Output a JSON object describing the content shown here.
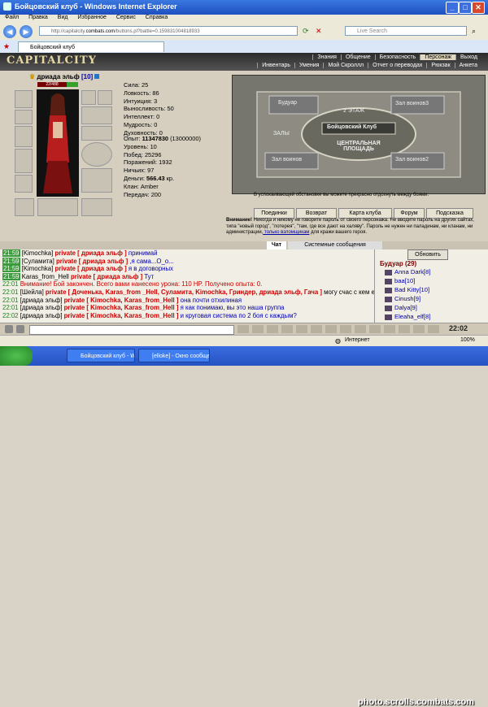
{
  "window": {
    "title": "Бойцовский клуб - Windows Internet Explorer"
  },
  "menu": [
    "Файл",
    "Правка",
    "Вид",
    "Избранное",
    "Сервис",
    "Справка"
  ],
  "address": {
    "prefix": "http://capitalcity.",
    "host": "combats.com",
    "path": "/buttons.pl?battle=0.159831004818933"
  },
  "search": {
    "placeholder": "Live Search"
  },
  "tab": {
    "label": "Бойцовский клуб"
  },
  "game": {
    "logo": "CAPITALCITY",
    "nav_top": [
      "Знания",
      "Общение",
      "Безопасность",
      "Персонаж",
      "Выход"
    ],
    "nav_sub": [
      "Инвентарь",
      "Умения",
      "Мой Скроллл",
      "Отчет о переводах",
      "Рюкзак",
      "Анкета"
    ]
  },
  "character": {
    "name": "дриада эльф",
    "level": "[10]",
    "hp": "22/488",
    "stats": [
      "Сила: 25",
      "Ловкость: 86",
      "Интуиция: 3",
      "Выносливость: 50",
      "Интеллект: 0",
      "Мудрость: 0",
      "Духовность: 0"
    ],
    "stats2": [
      {
        "label": "Опыт: ",
        "value": "11347830",
        "extra": " (13000000)"
      },
      {
        "label": "Уровень: 10"
      },
      {
        "label": "Побед: 25296"
      },
      {
        "label": "Поражений: 1932"
      },
      {
        "label": "Ничьих: 97"
      },
      {
        "label": "Деньги: ",
        "value": "566.43",
        "extra": " кр."
      },
      {
        "label": "Клан: Amber"
      },
      {
        "label": "Передач: 200"
      }
    ]
  },
  "map": {
    "labels": [
      "Будуар",
      "2 ЭТАЖ",
      "Зал воинов3",
      "Бойцовский Клуб",
      "ЗАЛЫ",
      "ЦЕНТРАЛЬНАЯ ПЛОЩАДЬ",
      "Зал воинов",
      "Зал воинов2"
    ],
    "tip": "В успокаивающей обстановке вы можете прекрасно отдохнуть между боями.",
    "buttons": [
      "Поединки",
      "Возврат",
      "Карта клуба",
      "Форум",
      "Подсказка"
    ]
  },
  "warning": {
    "title": "Внимание!",
    "text": " Никогда и никому не говорите пароль от своего персонажа. Не вводите пароль на других сайтах, типа \"новый город\", \"лотерея\", \"там, где все дают на халяву\". Пароль не нужен ни паладинам, ни кланам, ни администрации,",
    "link": " только взломщикам",
    "tail": " для кражи вашего героя."
  },
  "chat_tabs": [
    "Чат",
    "Системные сообщения"
  ],
  "chat": [
    {
      "time": "21:59",
      "nick": "[Kimochka]",
      "priv": "private [ дриада эльф ]",
      "msg": " принимай",
      "msgcls": "blue"
    },
    {
      "time": "21:59",
      "nick": "[Суламита]",
      "priv": "private [ дриада эльф ]",
      "msg": " ,я сама...О_о...",
      "msgcls": "blue"
    },
    {
      "time": "21:59",
      "nick": "[Kimochka]",
      "priv": "private [ дриада эльф ]",
      "msg": " я в договорных",
      "msgcls": "blue"
    },
    {
      "time": "21:59",
      "nick": "Karas_from_Hell",
      "priv": "private [ дриада эльф ]",
      "msg": " Тут",
      "msgcls": "blue"
    },
    {
      "time": "22:01",
      "nick": "",
      "priv": "",
      "msg": "Внимание! Бой закончен. Всего вами нанесено урона: 110 HP. Получено опыта: 0.",
      "msgcls": "red"
    },
    {
      "time": "22:01",
      "nick": "[Шейла]",
      "priv": "private [ Доченька, Karas_from _Hell, Суламита, Kimochka, Гриндер, дриада эльф, Гача ]",
      "msg": " могу счас с кем ещё не дралась:)",
      "msgcls": ""
    },
    {
      "time": "22:01",
      "nick": "[дриада эльф]",
      "priv": "private [ Kimochka, Karas_from_Hell ]",
      "msg": " она почти отхилиная",
      "msgcls": "blue"
    },
    {
      "time": "22:01",
      "nick": "[дриада эльф]",
      "priv": "private [ Kimochka, Karas_from_Hell ]",
      "msg": " я как понимаю, вы это наша группа",
      "msgcls": "blue"
    },
    {
      "time": "22:02",
      "nick": "[дриада эльф]",
      "priv": "private [ Kimochka, Karas_from_Hell ]",
      "msg": " и круговая система по 2 боя с каждым?",
      "msgcls": "blue"
    }
  ],
  "sidebar": {
    "refresh": "Обновить",
    "room": "Будуар (29)",
    "users": [
      "Anna Dark[8]",
      "baa[10]",
      "Bad Kitty[10]",
      "Cinush[9]",
      "Dalya[9]",
      "Eleaha_elf[8]"
    ]
  },
  "clock": "22:02",
  "status": {
    "zone": "Интернет",
    "zoom": "100%"
  },
  "taskbar": [
    "Бойцовский клуб - Wi...",
    "[elloke] - Окно сообще..."
  ],
  "watermark": "photo.scrolls.combats.com"
}
